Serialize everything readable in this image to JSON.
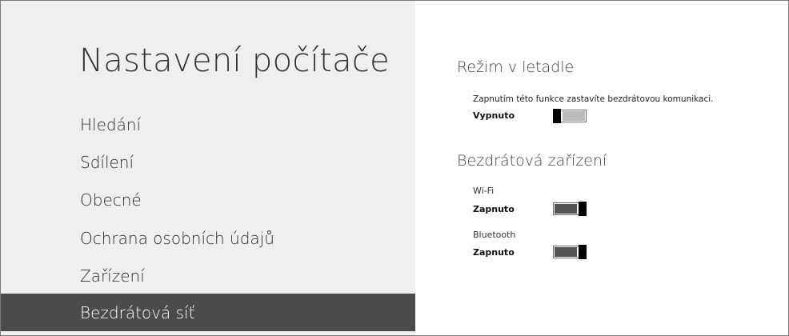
{
  "sidebar": {
    "title": "Nastavení počítače",
    "items": [
      {
        "label": "Hledání"
      },
      {
        "label": "Sdílení"
      },
      {
        "label": "Obecné"
      },
      {
        "label": "Ochrana osobních údajů"
      },
      {
        "label": "Zařízení"
      },
      {
        "label": "Bezdrátová síť",
        "selected": true
      }
    ]
  },
  "main": {
    "airplane": {
      "title": "Režim v letadle",
      "description": "Zapnutím této funkce zastavíte bezdrátovou komunikaci.",
      "state": "Vypnuto",
      "on": false
    },
    "devices": {
      "title": "Bezdrátová zařízení",
      "wifi": {
        "label": "Wi-Fi",
        "state": "Zapnuto",
        "on": true
      },
      "bluetooth": {
        "label": "Bluetooth",
        "state": "Zapnuto",
        "on": true
      }
    }
  },
  "colors": {
    "sidebar_bg": "#efefef",
    "selected_bg": "#4b4b4b",
    "toggle_on_fill": "#555555",
    "toggle_off_fill": "#bcbcbc"
  }
}
